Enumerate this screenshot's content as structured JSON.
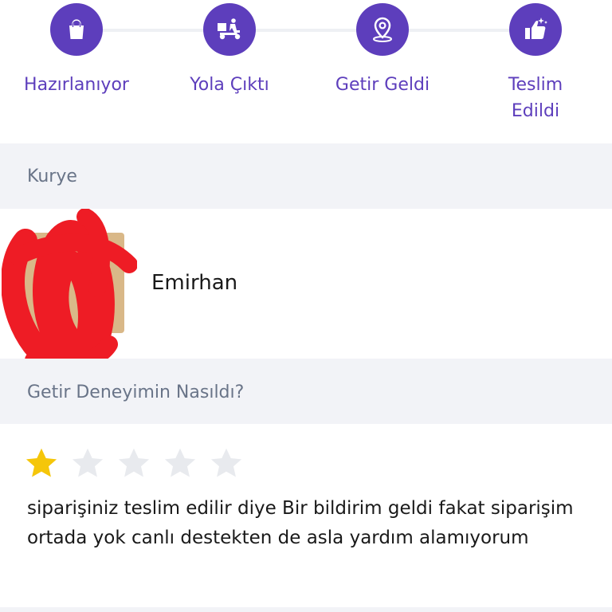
{
  "steps": [
    {
      "label_line1": "Hazırlanıyor",
      "label_line2": "",
      "icon": "shopping-bag-icon"
    },
    {
      "label_line1": "Yola Çıktı",
      "label_line2": "",
      "icon": "delivery-scooter-icon"
    },
    {
      "label_line1": "Getir Geldi",
      "label_line2": "",
      "icon": "location-pin-icon"
    },
    {
      "label_line1": "Teslim",
      "label_line2": "Edildi",
      "icon": "thumbs-up-sparkle-icon"
    }
  ],
  "courier_section": {
    "title": "Kurye"
  },
  "courier": {
    "name": "Emirhan"
  },
  "experience_section": {
    "title": "Getir Deneyimin Nasıldı?"
  },
  "rating": {
    "value": 1,
    "max": 5,
    "filled_color": "#f5c60a",
    "empty_color": "#e8eaee"
  },
  "comment": "siparişiniz teslim edilir diye Bir bildirim geldi fakat siparişim ortada yok canlı destekten de asla yardım alamıyorum",
  "colors": {
    "brand": "#5d3ebc",
    "section_bg": "#f2f3f7",
    "section_text": "#697488"
  }
}
